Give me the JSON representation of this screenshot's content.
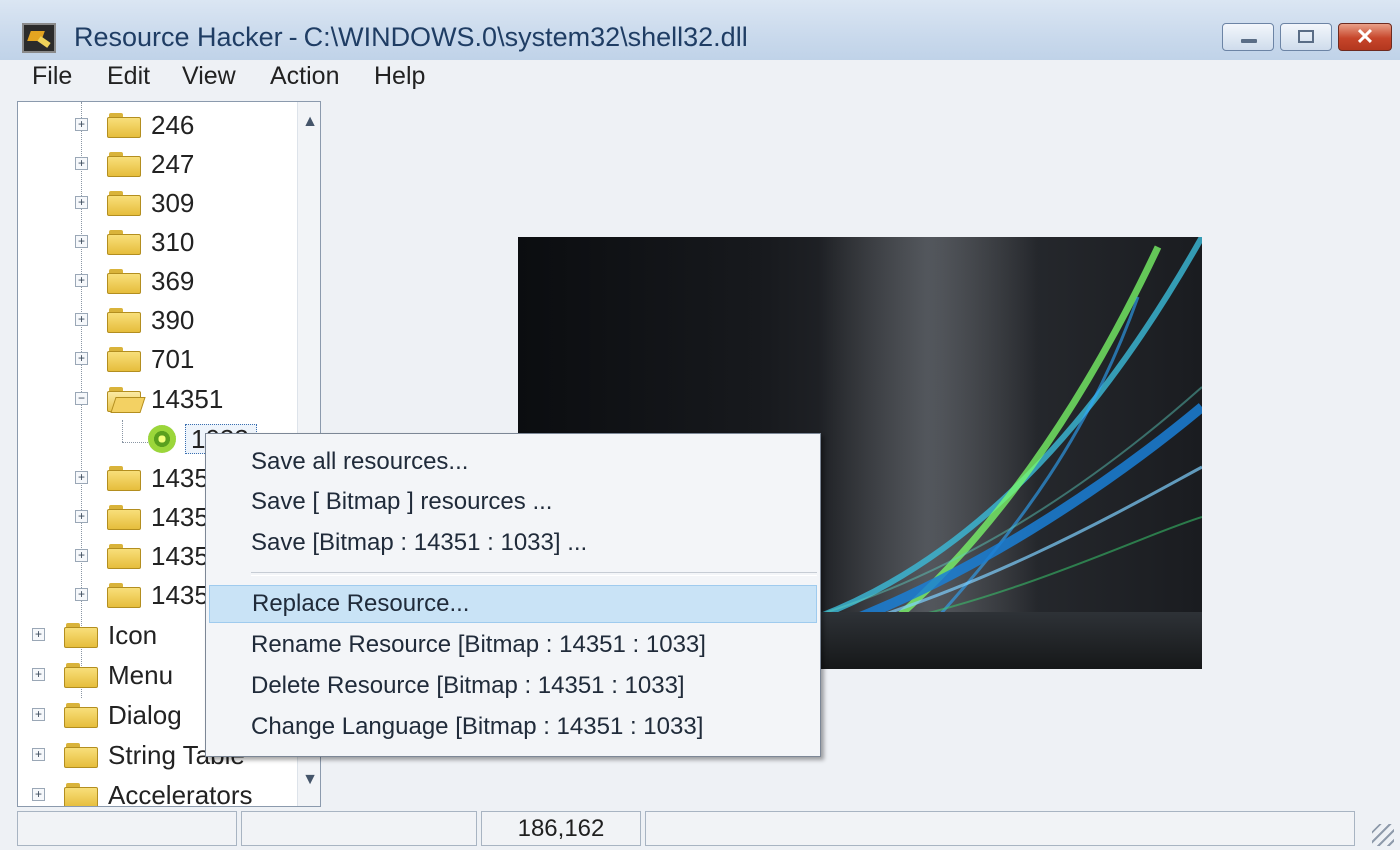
{
  "window": {
    "app_name": "Resource Hacker",
    "separator": "-",
    "file_path": "C:\\WINDOWS.0\\system32\\shell32.dll",
    "close_glyph": "✕"
  },
  "menubar": [
    "File",
    "Edit",
    "View",
    "Action",
    "Help"
  ],
  "tree": {
    "numbered_folders": [
      "246",
      "247",
      "309",
      "310",
      "369",
      "390",
      "701"
    ],
    "expanded_folder": "14351",
    "selected_leaf": "1033",
    "partial_folders": [
      "1435",
      "1435",
      "1435",
      "1435"
    ],
    "type_folders": [
      "Icon",
      "Menu",
      "Dialog",
      "String Table",
      "Accelerators"
    ]
  },
  "context_menu": {
    "items": [
      "Save all resources...",
      "Save [ Bitmap ] resources ...",
      "Save [Bitmap : 14351 : 1033] ...",
      "Replace Resource...",
      "Rename Resource [Bitmap : 14351 : 1033]",
      "Delete Resource [Bitmap : 14351 : 1033]",
      "Change Language [Bitmap : 14351 : 1033]"
    ],
    "highlighted_item": "Replace Resource..."
  },
  "statusbar": {
    "cells": [
      "",
      "",
      "186,162",
      ""
    ]
  },
  "colors": {
    "title_text": "#1f3d64",
    "menu_highlight": "#c9e3f6",
    "close_button": "#c6452a"
  },
  "icons": {
    "app": "resource-hacker-icon",
    "folder": "folder-icon",
    "leaf": "bitmap-gear-icon"
  }
}
